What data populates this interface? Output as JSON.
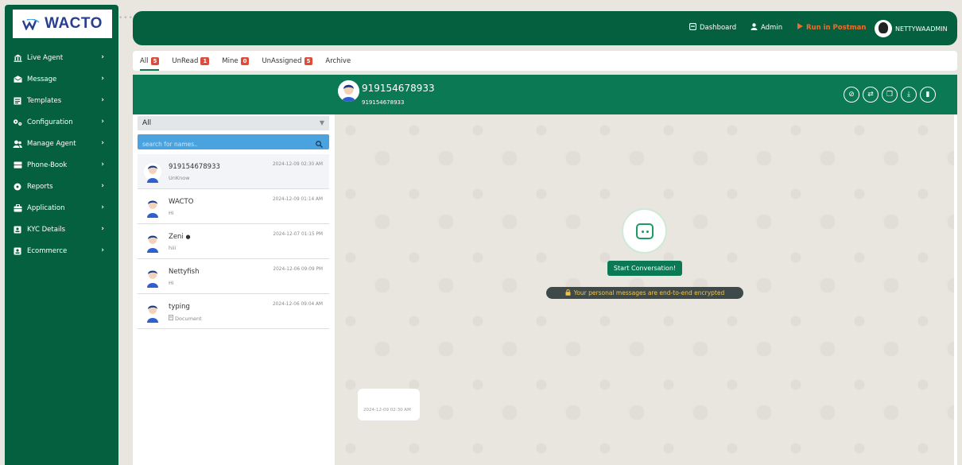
{
  "app": {
    "logo_text": "WACTO"
  },
  "sidebar": {
    "items": [
      {
        "label": "Live Agent",
        "icon": "bank-icon"
      },
      {
        "label": "Message",
        "icon": "envelope-icon"
      },
      {
        "label": "Templates",
        "icon": "template-icon"
      },
      {
        "label": "Configuration",
        "icon": "gears-icon"
      },
      {
        "label": "Manage Agent",
        "icon": "users-icon"
      },
      {
        "label": "Phone-Book",
        "icon": "server-icon"
      },
      {
        "label": "Reports",
        "icon": "circle-icon"
      },
      {
        "label": "Application",
        "icon": "briefcase-icon"
      },
      {
        "label": "KYC Details",
        "icon": "id-card-icon"
      },
      {
        "label": "Ecommerce",
        "icon": "id-card-icon"
      }
    ]
  },
  "topbar": {
    "dashboard": "Dashboard",
    "admin": "Admin",
    "postman": "Run in Postman",
    "user": "NETTYWAADMIN",
    "postman_color": "#f36b2b"
  },
  "tabs": [
    {
      "label": "All",
      "count": "5"
    },
    {
      "label": "UnRead",
      "count": "1"
    },
    {
      "label": "Mine",
      "count": "0"
    },
    {
      "label": "UnAssigned",
      "count": "5"
    },
    {
      "label": "Archive",
      "count": ""
    }
  ],
  "chat_header": {
    "name": "919154678933",
    "sub": "919154678933"
  },
  "filter": {
    "value": "All"
  },
  "search": {
    "placeholder": "search for names.."
  },
  "contacts": [
    {
      "name": "919154678933",
      "msg": "UnKnow",
      "time": "2024-12-09 02:30 AM"
    },
    {
      "name": "WACTO",
      "msg": "Hi",
      "time": "2024-12-09 01:14 AM"
    },
    {
      "name": "Zeni",
      "msg": "hiii",
      "time": "2024-12-07 01:15 PM"
    },
    {
      "name": "Nettyfish",
      "msg": "Hi",
      "time": "2024-12-06 09:09 PM"
    },
    {
      "name": "typing",
      "msg": "Document",
      "time": "2024-12-06 09:04 AM"
    }
  ],
  "chat": {
    "start_label": "Start Conversation!",
    "encrypted": "Your personal messages are end-to-end encrypted",
    "bubble_time": "2024-12-09 02:30 AM"
  },
  "colors": {
    "primary": "#05603f",
    "accent": "#0b7a54",
    "badge": "#e04a3b"
  }
}
